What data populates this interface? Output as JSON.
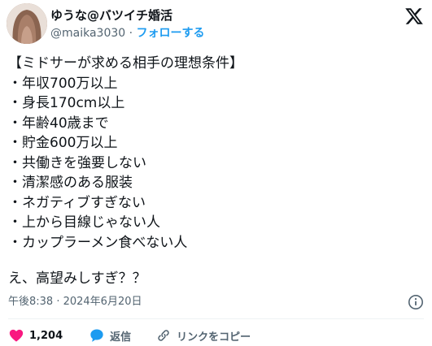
{
  "author": {
    "display_name": "ゆうな@バツイチ婚活",
    "handle": "@maika3030",
    "separator": "·",
    "follow_label": "フォローする"
  },
  "post": {
    "body": "【ミドサーが求める相手の理想条件】\n・年収700万以上\n・身長170cm以上\n・年齢40歳まで\n・貯金600万以上\n・共働きを強要しない\n・清潔感のある服装\n・ネガティブすぎない\n・上から目線じゃない人\n・カップラーメン食べない人",
    "closing": "え、高望みしすぎ？？",
    "timestamp": "午後8:38 · 2024年6月20日"
  },
  "actions": {
    "like_count": "1,204",
    "reply_label": "返信",
    "copy_link_label": "リンクをコピー"
  },
  "icons": {
    "brand": "x-logo-icon",
    "info": "info-icon",
    "like": "heart-icon",
    "reply": "speech-bubble-icon",
    "copy_link": "link-icon"
  },
  "colors": {
    "text": "#0f1419",
    "secondary": "#536471",
    "accent": "#1d9bf0",
    "like": "#f91880",
    "divider": "#eff3f4"
  }
}
